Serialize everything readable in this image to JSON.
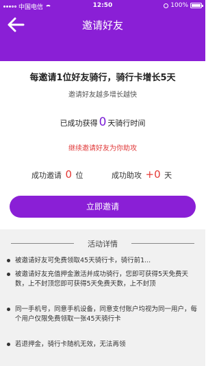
{
  "status_bar": {
    "carrier": "中国电信",
    "time": "12:50",
    "battery": "100%",
    "battery_level": 1.0
  },
  "nav": {
    "title": "邀请好友",
    "back_icon": "back-arrow-icon"
  },
  "invite": {
    "headline": "每邀请1位好友骑行，骑行卡增长5天",
    "subline": "邀请好友越多增长越快",
    "obtained_prefix": "已成功获得",
    "obtained_days": "0",
    "obtained_suffix": "天骑行时间",
    "continue_hint": "继续邀请好友为你助攻"
  },
  "stats": {
    "invited_label": "成功邀请",
    "invited_count": "0",
    "invited_unit": "位",
    "assist_label": "成功助攻",
    "assist_count": "+0",
    "assist_unit": "天"
  },
  "button": {
    "invite_label": "立即邀请"
  },
  "details": {
    "title": "活动详情",
    "rules": [
      "被邀请好友可免费领取45天骑行卡，骑行前1...",
      "被邀请好友充值押金激活并成功骑行，您即可获得5天免费天数，上不封顶您即可获得5天免费天数，上不封顶",
      "同一手机号，同意手机设备，同意支付账户均视为同一用户，每个用户仅限免费领取一张45天骑行卡",
      "若退押金，骑行卡随机无效，无法再领"
    ]
  },
  "colors": {
    "brand_purple": "#8a1fd6",
    "accent_red": "#e03a3a",
    "count_purple": "#7b1fd6"
  }
}
